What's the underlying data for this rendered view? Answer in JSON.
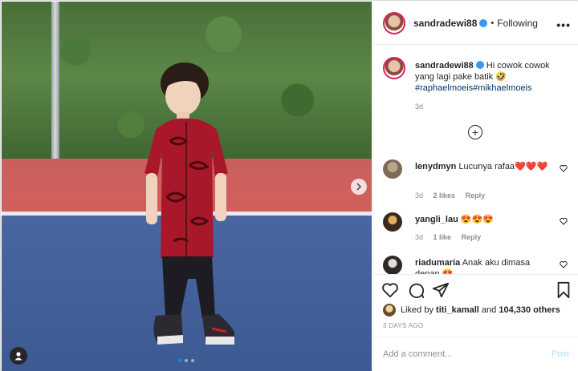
{
  "post": {
    "username": "sandradewi88",
    "follow_status": "Following",
    "separator": "•",
    "more_glyph": "•••",
    "verified_color": "#3897f0"
  },
  "caption": {
    "username": "sandradewi88",
    "text": "Hi cowok cowok yang lagi pake batik 🤣",
    "hashtags": "#raphaelmoeis#mikhaelmoeis",
    "time": "3d"
  },
  "load_more_glyph": "+",
  "comments": [
    {
      "username": "lenydmyn",
      "text": "Lucunya rafaa",
      "emoji": "❤️❤️❤️",
      "time": "3d",
      "likes": "2 likes",
      "reply": "Reply"
    },
    {
      "username": "yangli_lau",
      "text": "",
      "emoji": "😍😍😍",
      "time": "3d",
      "likes": "1 like",
      "reply": "Reply"
    },
    {
      "username": "riadumaria",
      "text": "Anak aku dimasa depan 😍",
      "emoji": "",
      "time": "",
      "likes": "",
      "reply": ""
    }
  ],
  "likes_line": {
    "prefix": "Liked by",
    "user": "titi_kamall",
    "middle": "and",
    "count": "104,330 others"
  },
  "time_ago": "3 DAYS AGO",
  "add_comment": {
    "placeholder": "Add a comment...",
    "post_label": "Post"
  },
  "carousel": {
    "index": 1,
    "total": 3
  },
  "icons": {
    "heart": "heart-icon",
    "comment": "comment-icon",
    "share": "share-icon",
    "save": "bookmark-icon",
    "next": "chevron-right-icon",
    "user_tag": "user-icon",
    "comment_like": "heart-outline-icon"
  },
  "colors": {
    "link": "#00376b",
    "muted": "#8e8e8e",
    "post_button": "#b2dffc",
    "accent_blue": "#0095f6"
  }
}
